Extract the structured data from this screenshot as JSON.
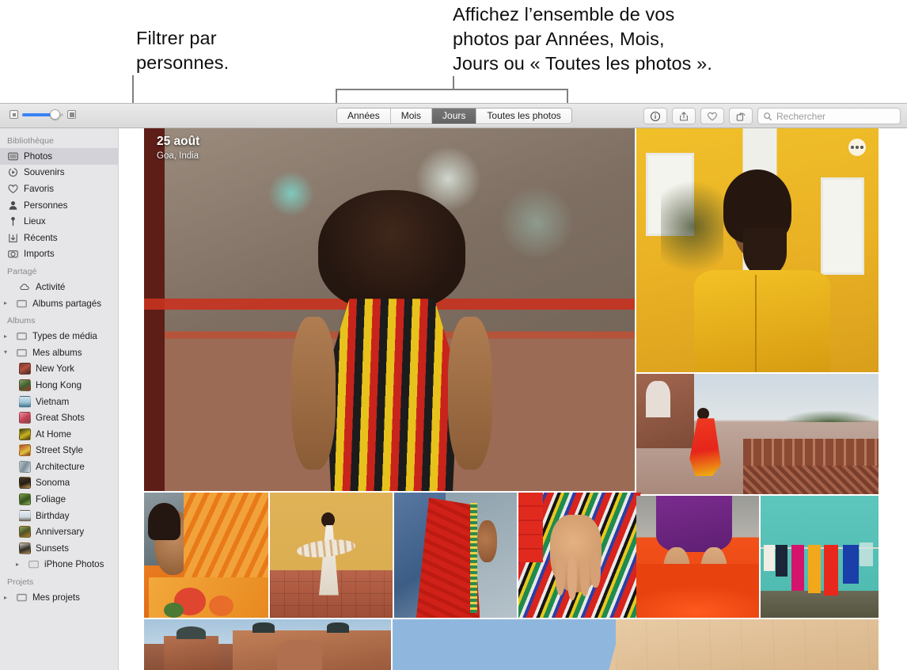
{
  "callouts": {
    "left": "Filtrer par\npersonnes.",
    "right": "Affichez l’ensemble de vos\nphotos par Années, Mois,\nJours ou « Toutes les photos »."
  },
  "toolbar": {
    "zoom_slider": {
      "small_icon": "small-thumbnail-icon",
      "large_icon": "large-thumbnail-icon",
      "value": 75
    },
    "segments": [
      {
        "label": "Années",
        "active": false
      },
      {
        "label": "Mois",
        "active": false
      },
      {
        "label": "Jours",
        "active": true
      },
      {
        "label": "Toutes les photos",
        "active": false
      }
    ],
    "buttons": [
      {
        "name": "info-icon",
        "label": "Informations"
      },
      {
        "name": "share-icon",
        "label": "Partager"
      },
      {
        "name": "heart-icon",
        "label": "Favori"
      },
      {
        "name": "rotate-icon",
        "label": "Faire pivoter"
      }
    ],
    "search": {
      "icon": "search-icon",
      "placeholder": "Rechercher",
      "value": ""
    }
  },
  "sidebar": {
    "sections": [
      {
        "title": "Bibliothèque",
        "items": [
          {
            "label": "Photos",
            "icon": "photos-icon",
            "selected": true,
            "disclosure": false
          },
          {
            "label": "Souvenirs",
            "icon": "memories-icon",
            "selected": false,
            "disclosure": false
          },
          {
            "label": "Favoris",
            "icon": "heart-icon",
            "selected": false,
            "disclosure": false
          },
          {
            "label": "Personnes",
            "icon": "person-icon",
            "selected": false,
            "disclosure": false
          },
          {
            "label": "Lieux",
            "icon": "pin-icon",
            "selected": false,
            "disclosure": false
          },
          {
            "label": "Récents",
            "icon": "recents-icon",
            "selected": false,
            "disclosure": false
          },
          {
            "label": "Imports",
            "icon": "imports-icon",
            "selected": false,
            "disclosure": false
          }
        ]
      },
      {
        "title": "Partagé",
        "items": [
          {
            "label": "Activité",
            "icon": "cloud-icon",
            "selected": false,
            "disclosure": false
          },
          {
            "label": "Albums partagés",
            "icon": "folder-icon",
            "selected": false,
            "disclosure": "collapsed"
          }
        ]
      },
      {
        "title": "Albums",
        "items": [
          {
            "label": "Types de média",
            "icon": "folder-icon",
            "selected": false,
            "disclosure": "collapsed"
          },
          {
            "label": "Mes albums",
            "icon": "folder-icon",
            "selected": false,
            "disclosure": "expanded"
          },
          {
            "label": "New York",
            "icon": "album-thumb",
            "thumb": "#8a4436",
            "indent": true
          },
          {
            "label": "Hong Kong",
            "icon": "album-thumb",
            "thumb": "#5d7a4a",
            "indent": true
          },
          {
            "label": "Vietnam",
            "icon": "album-thumb",
            "thumb": "#9fc5d4",
            "indent": true
          },
          {
            "label": "Great Shots",
            "icon": "album-thumb",
            "thumb": "#c4566a",
            "indent": true
          },
          {
            "label": "At Home",
            "icon": "album-thumb",
            "thumb": "#c6b020",
            "indent": true
          },
          {
            "label": "Street Style",
            "icon": "album-thumb",
            "thumb": "#b4462f",
            "indent": true
          },
          {
            "label": "Architecture",
            "icon": "album-thumb",
            "thumb": "#8fa0a8",
            "indent": true
          },
          {
            "label": "Sonoma",
            "icon": "album-thumb",
            "thumb": "#3f3528",
            "indent": true
          },
          {
            "label": "Foliage",
            "icon": "album-thumb",
            "thumb": "#4e6b2c",
            "indent": true
          },
          {
            "label": "Birthday",
            "icon": "album-thumb",
            "thumb": "#d4dce2",
            "indent": true
          },
          {
            "label": "Anniversary",
            "icon": "album-thumb",
            "thumb": "#6e7a3a",
            "indent": true
          },
          {
            "label": "Sunsets",
            "icon": "album-thumb",
            "thumb": "#3a3a38",
            "indent": true
          },
          {
            "label": "iPhone Photos",
            "icon": "folder-icon",
            "selected": false,
            "disclosure": "collapsed",
            "indent": true
          }
        ]
      },
      {
        "title": "Projets",
        "items": [
          {
            "label": "Mes projets",
            "icon": "folder-icon",
            "selected": false,
            "disclosure": "collapsed"
          }
        ]
      }
    ]
  },
  "grid": {
    "day_header": {
      "date": "25 août",
      "place": "Goa, India"
    },
    "more_button": "more-options-icon",
    "photos": [
      {
        "name": "photo-woman-against-painted-wall",
        "alt": "Femme adossée à un mur peint"
      },
      {
        "name": "photo-man-yellow-house",
        "alt": "Homme en kurta jaune devant une maison jaune"
      },
      {
        "name": "photo-woman-red-sari-taj",
        "alt": "Femme en sari rouge au Taj Mahal"
      },
      {
        "name": "photo-woman-orange-headscarf",
        "alt": "Femme au foulard orange"
      },
      {
        "name": "photo-woman-white-sari-dancing",
        "alt": "Femme en sari blanc dansant"
      },
      {
        "name": "photo-woman-red-veil-blue-wall",
        "alt": "Femme au voile rouge devant un mur bleu"
      },
      {
        "name": "photo-hand-striped-fabric",
        "alt": "Main tenant un tissu rayé"
      },
      {
        "name": "photo-feet-orange-powder",
        "alt": "Pieds dans de la poudre orange"
      },
      {
        "name": "photo-laundry-turquoise-wall",
        "alt": "Linge séchant sur un mur turquoise"
      },
      {
        "name": "photo-mughal-architecture",
        "alt": "Architecture moghole"
      },
      {
        "name": "photo-sky-and-sandstone-wall",
        "alt": "Ciel et mur de grès"
      }
    ]
  },
  "colors": {
    "accent": "#3b82f6",
    "toolbar_bg": "#e4e4e4",
    "sidebar_bg": "#e6e6e8",
    "selection": "#d2d2d8",
    "leader_line": "#808080"
  }
}
